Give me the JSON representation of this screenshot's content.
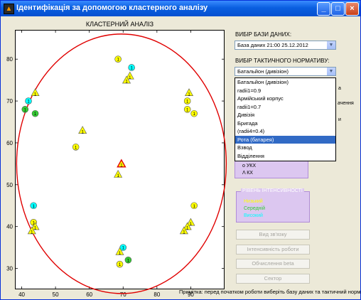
{
  "window": {
    "title": "Ідентифікація за допомогою кластерного аналізу",
    "icon_name": "matlab-figure-icon",
    "controls": {
      "minimize": "_",
      "maximize": "□",
      "close": "×"
    }
  },
  "database": {
    "label": "ВИБІР БАЗИ ДАНИХ:",
    "selected": "База даних 21:00 25.12.2012"
  },
  "norm": {
    "label": "ВИБІР ТАКТИЧНОГО НОРМАТИВУ:",
    "selected": "Батальйон (дивізіон)",
    "options": [
      "Батальйон (дивізіон)",
      "radii1=0.9",
      "Армійський корпус",
      "radii1=0.7",
      "Дивізія",
      "Бригада",
      "(radii4=0.4)",
      "Рота (батарея)",
      "Взвод",
      "Відділення"
    ],
    "highlighted_index": 7
  },
  "hidden_partial": {
    "text1": "а",
    "text2": "ачення",
    "text3": "и"
  },
  "legend_panel": {
    "items": [
      "о УКХ",
      "Λ КХ"
    ]
  },
  "intensity_panel": {
    "title": "РІВЕНЬ ІНТЕНСИВНОСТІ",
    "levels": [
      {
        "label": "Низький",
        "color": "#ffff00"
      },
      {
        "label": "Середній",
        "color": "#33cc33"
      },
      {
        "label": "Високий",
        "color": "#00ffff"
      }
    ]
  },
  "buttons": {
    "link_view": "Вид зв'язку",
    "work_intensity": "Інтенсивність роботи",
    "calc_beta": "Обчислення beta",
    "sector": "Сектор"
  },
  "note": "Примітка: перед початком роботи виберіть базу даних та тактичний норматив",
  "colors": {
    "circle": "#e00000",
    "yellow": "#ffff00",
    "green": "#33cc33",
    "cyan": "#00ffff",
    "selected_row": "#316ac5"
  },
  "chart_data": {
    "type": "scatter",
    "title": "КЛАСТЕРНИЙ АНАЛІЗ",
    "xlim": [
      38,
      100
    ],
    "ylim": [
      25,
      87
    ],
    "xticks": [
      40,
      50,
      60,
      70,
      80,
      90
    ],
    "yticks": [
      30,
      40,
      50,
      60,
      70,
      80
    ],
    "circle": {
      "center": [
        69.5,
        55
      ],
      "radius": 31
    },
    "markers": [
      {
        "x": 68.5,
        "y": 80,
        "shape": "circle",
        "color": "yellow"
      },
      {
        "x": 72.5,
        "y": 78,
        "shape": "circle",
        "color": "cyan"
      },
      {
        "x": 72,
        "y": 76,
        "shape": "triangle",
        "color": "yellow"
      },
      {
        "x": 71,
        "y": 75,
        "shape": "triangle",
        "color": "yellow"
      },
      {
        "x": 44,
        "y": 72,
        "shape": "triangle",
        "color": "yellow"
      },
      {
        "x": 42,
        "y": 70,
        "shape": "circle",
        "color": "cyan"
      },
      {
        "x": 41,
        "y": 68,
        "shape": "circle",
        "color": "green"
      },
      {
        "x": 44,
        "y": 67,
        "shape": "circle",
        "color": "green"
      },
      {
        "x": 58,
        "y": 63,
        "shape": "triangle",
        "color": "yellow"
      },
      {
        "x": 56,
        "y": 59,
        "shape": "circle",
        "color": "yellow"
      },
      {
        "x": 89.5,
        "y": 72,
        "shape": "triangle",
        "color": "yellow"
      },
      {
        "x": 89,
        "y": 70,
        "shape": "circle",
        "color": "yellow"
      },
      {
        "x": 89,
        "y": 68,
        "shape": "circle",
        "color": "yellow"
      },
      {
        "x": 91,
        "y": 67,
        "shape": "circle",
        "color": "yellow"
      },
      {
        "x": 69.5,
        "y": 55,
        "shape": "triangle",
        "color": "red-highlight"
      },
      {
        "x": 68.5,
        "y": 52.5,
        "shape": "triangle",
        "color": "yellow"
      },
      {
        "x": 43.5,
        "y": 45,
        "shape": "circle",
        "color": "cyan"
      },
      {
        "x": 43.5,
        "y": 41,
        "shape": "circle",
        "color": "yellow"
      },
      {
        "x": 44,
        "y": 40,
        "shape": "triangle",
        "color": "yellow"
      },
      {
        "x": 43,
        "y": 39,
        "shape": "triangle",
        "color": "yellow"
      },
      {
        "x": 91,
        "y": 45,
        "shape": "circle",
        "color": "yellow"
      },
      {
        "x": 90,
        "y": 41,
        "shape": "triangle",
        "color": "yellow"
      },
      {
        "x": 89,
        "y": 40,
        "shape": "triangle",
        "color": "yellow"
      },
      {
        "x": 88,
        "y": 39,
        "shape": "triangle",
        "color": "yellow"
      },
      {
        "x": 70,
        "y": 35,
        "shape": "circle",
        "color": "cyan"
      },
      {
        "x": 69,
        "y": 34,
        "shape": "triangle",
        "color": "yellow"
      },
      {
        "x": 71.5,
        "y": 32,
        "shape": "circle",
        "color": "green"
      },
      {
        "x": 69,
        "y": 31,
        "shape": "circle",
        "color": "yellow"
      }
    ]
  }
}
